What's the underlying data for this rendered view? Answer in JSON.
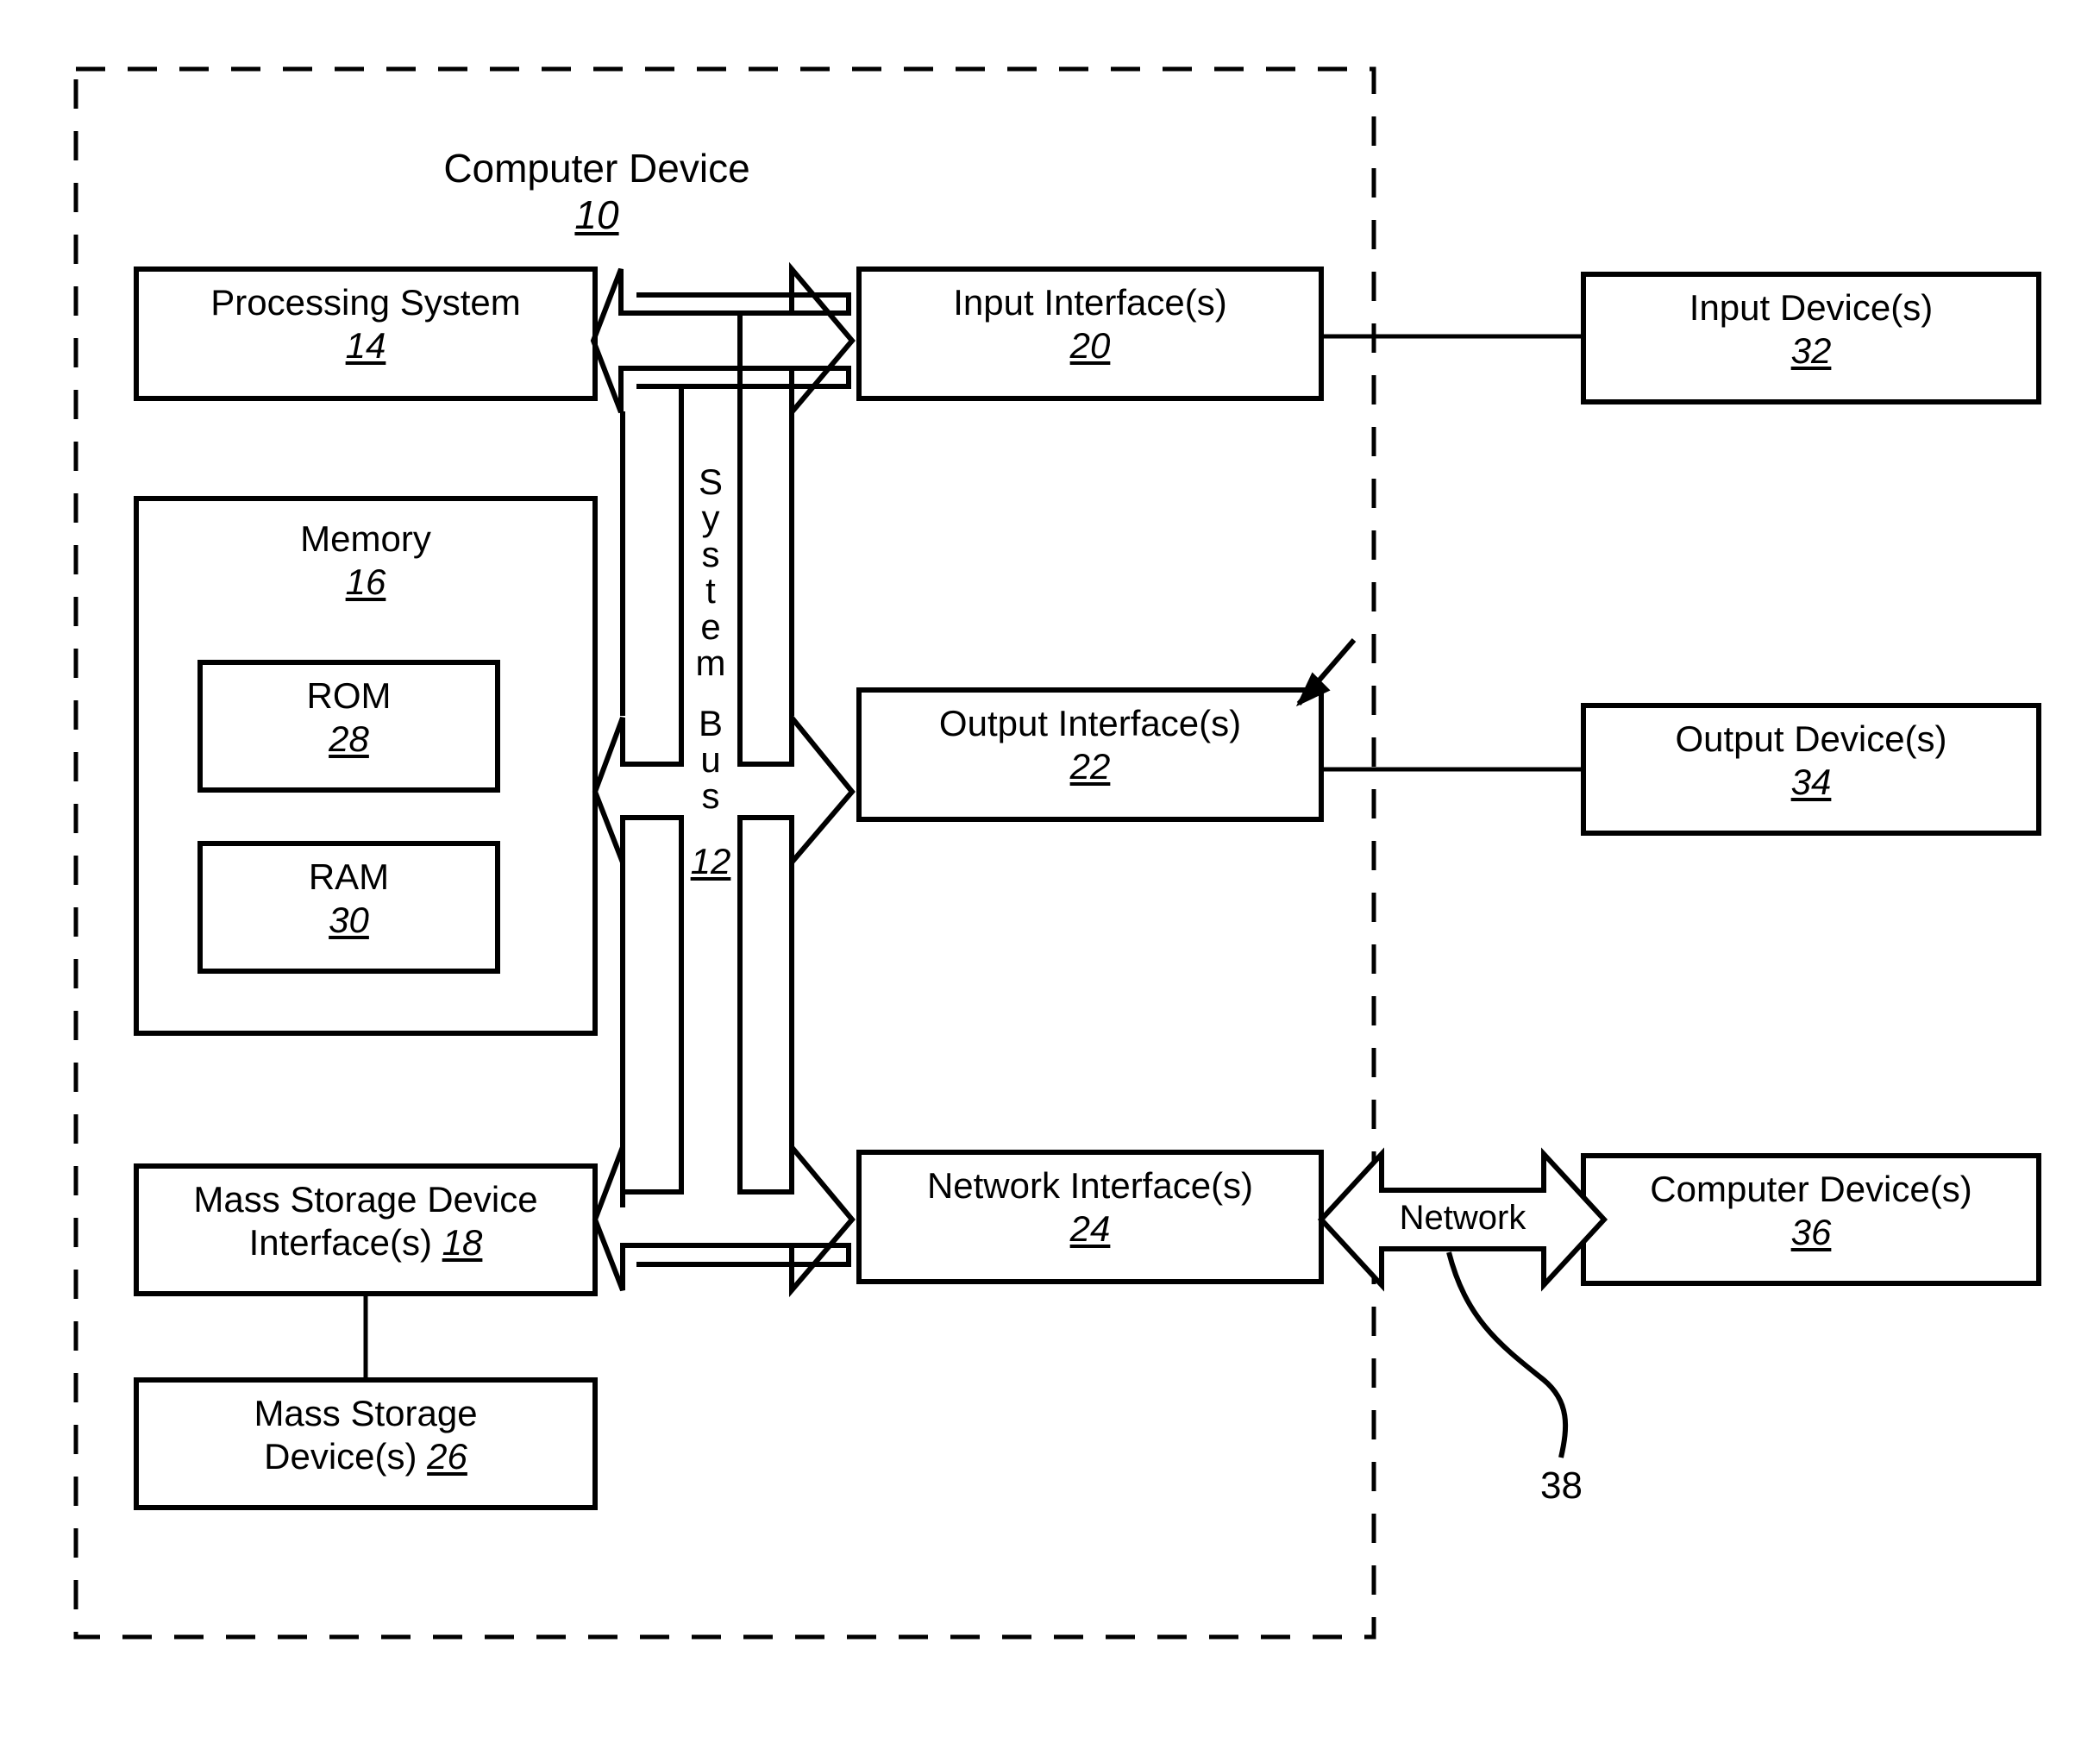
{
  "figure": {
    "title": "Computer Device",
    "title_ref": "10",
    "boundary": "dashed-enclosure"
  },
  "bus": {
    "label_letters": [
      "S",
      "y",
      "s",
      "t",
      "e",
      "m",
      "B",
      "u",
      "s"
    ],
    "word1": "System",
    "word2": "Bus",
    "ref": "12"
  },
  "blocks": {
    "processing_system": {
      "label": "Processing System",
      "ref": "14"
    },
    "memory": {
      "label": "Memory",
      "ref": "16"
    },
    "rom": {
      "label": "ROM",
      "ref": "28"
    },
    "ram": {
      "label": "RAM",
      "ref": "30"
    },
    "mass_storage_interface": {
      "label_line1": "Mass Storage Device",
      "label_line2": "Interface(s)",
      "ref": "18"
    },
    "mass_storage_devices": {
      "label_line1": "Mass Storage",
      "label_line2": "Device(s)",
      "ref": "26"
    },
    "input_interface": {
      "label": "Input Interface(s)",
      "ref": "20"
    },
    "output_interface": {
      "label": "Output Interface(s)",
      "ref": "22"
    },
    "network_interface": {
      "label": "Network Interface(s)",
      "ref": "24"
    },
    "input_devices": {
      "label": "Input Device(s)",
      "ref": "32"
    },
    "output_devices": {
      "label": "Output Device(s)",
      "ref": "34"
    },
    "computer_devices": {
      "label": "Computer Device(s)",
      "ref": "36"
    }
  },
  "network": {
    "label": "Network",
    "ref": "38"
  },
  "colors": {
    "stroke": "#000000",
    "background": "#ffffff"
  }
}
